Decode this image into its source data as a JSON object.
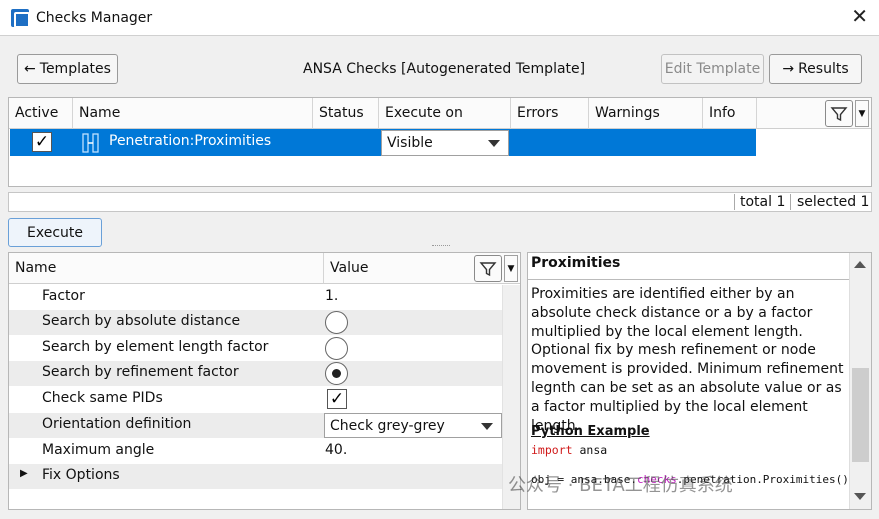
{
  "window": {
    "title": "Checks Manager",
    "close_glyph": "✕"
  },
  "toolbar": {
    "templates_label": "Templates",
    "center_title": "ANSA Checks [Autogenerated Template]",
    "edit_template_label": "Edit Template",
    "results_label": "Results"
  },
  "checks_table": {
    "columns": [
      "Active",
      "Name",
      "Status",
      "Execute on",
      "Errors",
      "Warnings",
      "Info"
    ],
    "rows": [
      {
        "active": true,
        "name": "Penetration:Proximities",
        "status": "",
        "execute_on": "Visible",
        "errors": "",
        "warnings": "",
        "info": ""
      }
    ]
  },
  "status": {
    "total": "total 1",
    "selected": "selected 1"
  },
  "execute_label": "Execute",
  "params": {
    "headers": [
      "Name",
      "Value"
    ],
    "rows": [
      {
        "name": "Factor",
        "value": "1."
      },
      {
        "name": "Search by absolute distance",
        "type": "radio",
        "checked": false
      },
      {
        "name": "Search by element length factor",
        "type": "radio",
        "checked": false
      },
      {
        "name": "Search by refinement factor",
        "type": "radio",
        "checked": true
      },
      {
        "name": "Check same PIDs",
        "type": "checkbox",
        "checked": true
      },
      {
        "name": "Orientation definition",
        "value": "Check grey-grey"
      },
      {
        "name": "Maximum angle",
        "value": "40."
      },
      {
        "name": "Fix Options"
      }
    ]
  },
  "info": {
    "title": "Proximities",
    "description": "Proximities are identified either by an absolute check distance or a by a factor multiplied by the local element length. Optional fix by mesh refinement or node movement is provided. Minimum refinement legnth can be set as an absolute value or as a factor multiplied by the local element length.",
    "python_title": "Python Example",
    "code_import_kw": "import",
    "code_import_mod": "ansa",
    "code_line_pre": "obj = ansa.base.",
    "code_line_kw": "checks",
    "code_line_post": ".penetration.Proximities()"
  },
  "watermark": "公众号 · BETA工程仿真系统",
  "icons": [
    "app-logo-icon",
    "close-icon",
    "arrow-left-icon",
    "arrow-right-icon",
    "filter-icon",
    "chevron-down-icon",
    "check-item-icon",
    "expand-arrow-icon"
  ],
  "colors": {
    "selection": "#0078d7",
    "keyword": "#d01a1a",
    "keyword2": "#c21fc2"
  }
}
